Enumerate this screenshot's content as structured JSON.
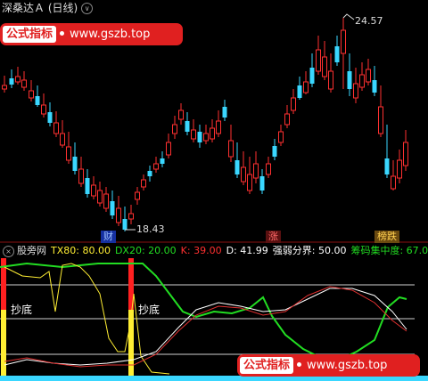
{
  "header": {
    "title": "深桑达Ａ (日线)",
    "circle_icon": "∨"
  },
  "badge_top": {
    "left": "公式指标",
    "url": "www.gszb.top"
  },
  "badge_bottom": {
    "left": "公式指标",
    "url": "www.gszb.top"
  },
  "price": {
    "high_label": "24.57",
    "low_label": "18.43"
  },
  "tags": {
    "cai": "财",
    "zhang": "涨",
    "bang": "榜跌"
  },
  "indicator": {
    "name": "股旁网",
    "tx": "TX80: 80.00",
    "dx": "DX20: 20.00",
    "k": "K: 39.00",
    "d": "D: 41.99",
    "strong": "强弱分界: 50.00",
    "chip": "筹码集中度: 67.0"
  },
  "signals": {
    "chaodi1": "抄底",
    "chaodi2": "抄底"
  },
  "colors": {
    "up": "#ff3030",
    "down": "#3ad7ff",
    "green": "#22dd22",
    "yellow": "#ffee33",
    "white": "#ffffff",
    "red": "#ff2020",
    "magenta": "#ff40ff"
  }
}
